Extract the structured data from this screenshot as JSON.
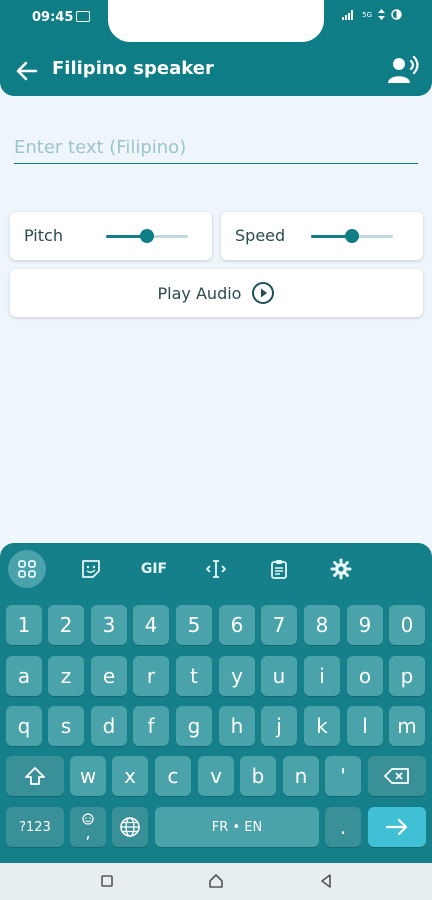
{
  "status": {
    "time": "09:45",
    "right_text": "5G"
  },
  "app_bar": {
    "title": "Filipino speaker"
  },
  "input": {
    "placeholder": "Enter text (Filipino)",
    "value": ""
  },
  "controls": {
    "pitch": {
      "label": "Pitch",
      "value": 0.5
    },
    "speed": {
      "label": "Speed",
      "value": 0.5
    }
  },
  "play": {
    "label": "Play Audio"
  },
  "keyboard": {
    "toolbar": {
      "gif": "GIF"
    },
    "rows": [
      [
        "1",
        "2",
        "3",
        "4",
        "5",
        "6",
        "7",
        "8",
        "9",
        "0"
      ],
      [
        "a",
        "z",
        "e",
        "r",
        "t",
        "y",
        "u",
        "i",
        "o",
        "p"
      ],
      [
        "q",
        "s",
        "d",
        "f",
        "g",
        "h",
        "j",
        "k",
        "l",
        "m"
      ],
      [
        "w",
        "x",
        "c",
        "v",
        "b",
        "n",
        "'"
      ]
    ],
    "symbols": "?123",
    "emoji_comma": ",",
    "space": "FR • EN",
    "period": "."
  },
  "icons": {
    "back": "arrow-left-icon",
    "speaker": "voice-speaker-icon",
    "play": "play-circle-icon"
  },
  "colors": {
    "primary": "#0f7d86",
    "key": "#4aa2ab",
    "enter": "#40c0d4",
    "background": "#eef6fb"
  }
}
